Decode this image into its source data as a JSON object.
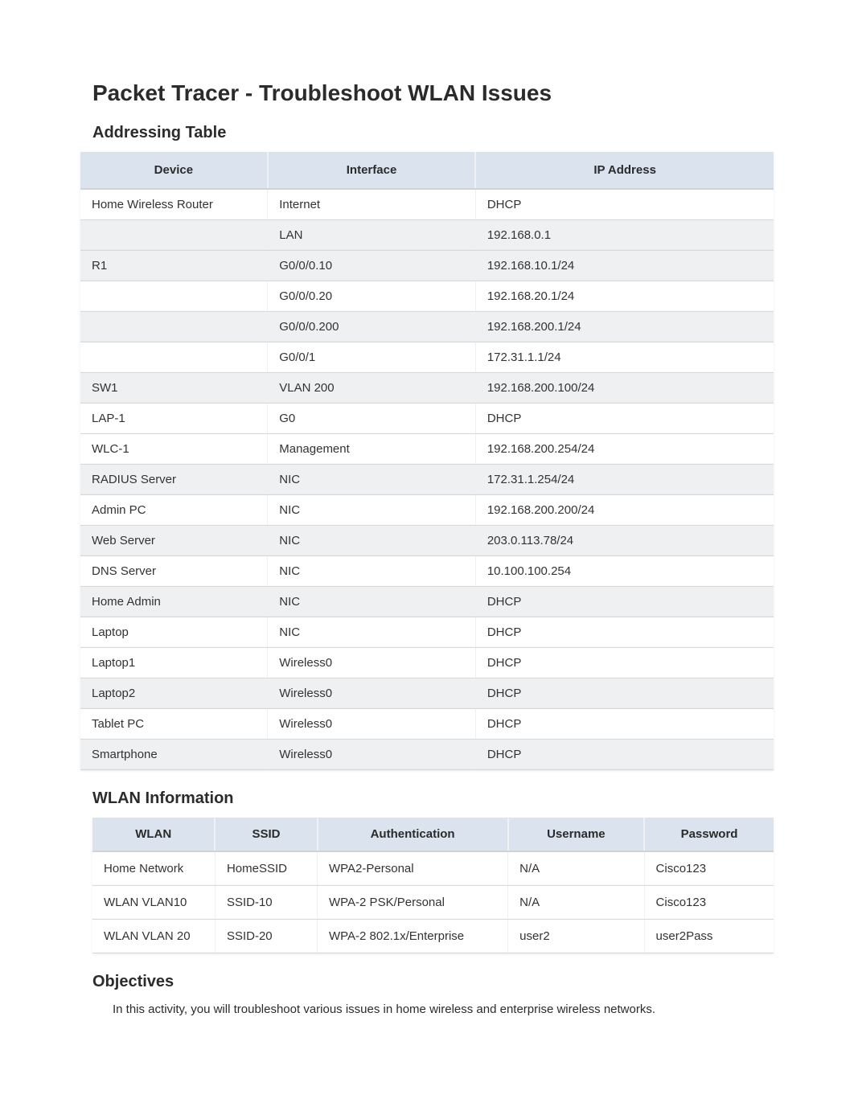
{
  "title": "Packet Tracer - Troubleshoot WLAN Issues",
  "sections": {
    "addressing": "Addressing Table",
    "wlan": "WLAN Information",
    "objectives": "Objectives"
  },
  "addressing_headers": {
    "device": "Device",
    "interface": "Interface",
    "ip": "IP Address"
  },
  "addressing_rows": [
    {
      "device": "Home Wireless Router",
      "interface": "Internet",
      "ip": "DHCP"
    },
    {
      "device": "",
      "interface": "LAN",
      "ip": "192.168.0.1"
    },
    {
      "device": "R1",
      "interface": "G0/0/0.10",
      "ip": "192.168.10.1/24"
    },
    {
      "device": "",
      "interface": "G0/0/0.20",
      "ip": "192.168.20.1/24"
    },
    {
      "device": "",
      "interface": "G0/0/0.200",
      "ip": "192.168.200.1/24"
    },
    {
      "device": "",
      "interface": "G0/0/1",
      "ip": "172.31.1.1/24"
    },
    {
      "device": "SW1",
      "interface": "VLAN 200",
      "ip": "192.168.200.100/24"
    },
    {
      "device": "LAP-1",
      "interface": "G0",
      "ip": "DHCP"
    },
    {
      "device": "WLC-1",
      "interface": "Management",
      "ip": "192.168.200.254/24"
    },
    {
      "device": "RADIUS Server",
      "interface": "NIC",
      "ip": "172.31.1.254/24"
    },
    {
      "device": "Admin PC",
      "interface": "NIC",
      "ip": "192.168.200.200/24"
    },
    {
      "device": "Web Server",
      "interface": "NIC",
      "ip": "203.0.113.78/24"
    },
    {
      "device": "DNS Server",
      "interface": "NIC",
      "ip": "10.100.100.254"
    },
    {
      "device": "Home Admin",
      "interface": "NIC",
      "ip": "DHCP"
    },
    {
      "device": "Laptop",
      "interface": "NIC",
      "ip": "DHCP"
    },
    {
      "device": "Laptop1",
      "interface": "Wireless0",
      "ip": "DHCP"
    },
    {
      "device": "Laptop2",
      "interface": "Wireless0",
      "ip": "DHCP"
    },
    {
      "device": "Tablet PC",
      "interface": "Wireless0",
      "ip": "DHCP"
    },
    {
      "device": "Smartphone",
      "interface": "Wireless0",
      "ip": "DHCP"
    }
  ],
  "wlan_headers": {
    "wlan": "WLAN",
    "ssid": "SSID",
    "auth": "Authentication",
    "user": "Username",
    "pass": "Password"
  },
  "wlan_rows": [
    {
      "wlan": "Home Network",
      "ssid": "HomeSSID",
      "auth": "WPA2-Personal",
      "user": "N/A",
      "pass": "Cisco123"
    },
    {
      "wlan": "WLAN VLAN10",
      "ssid": "SSID-10",
      "auth": "WPA-2 PSK/Personal",
      "user": "N/A",
      "pass": "Cisco123"
    },
    {
      "wlan": "WLAN VLAN 20",
      "ssid": "SSID-20",
      "auth": "WPA-2 802.1x/Enterprise",
      "user": "user2",
      "pass": "user2Pass"
    }
  ],
  "objectives_text": "In this activity, you will troubleshoot various issues in home wireless and enterprise wireless networks."
}
